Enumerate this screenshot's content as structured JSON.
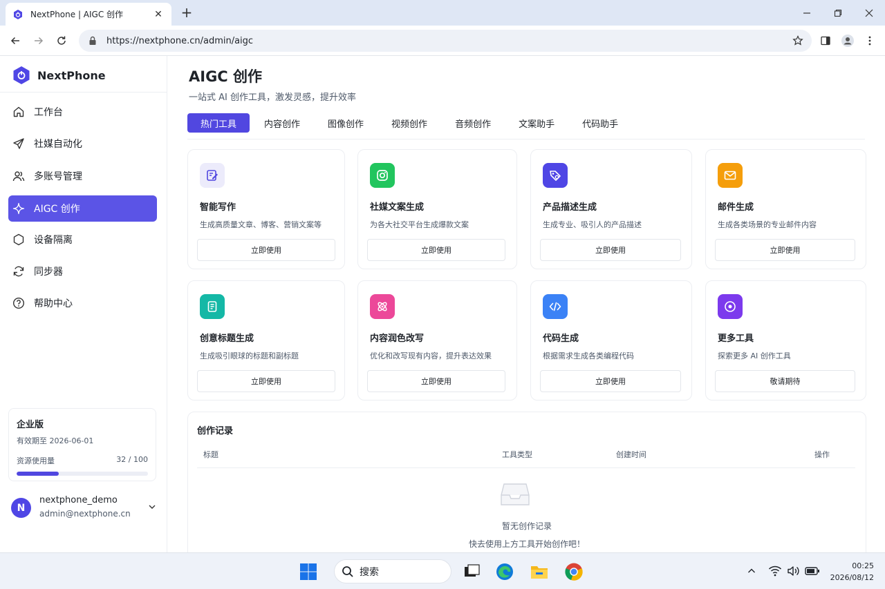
{
  "browser": {
    "tab_title": "NextPhone | AIGC 创作",
    "url": "https://nextphone.cn/admin/aigc"
  },
  "sidebar": {
    "brand": "NextPhone",
    "items": [
      {
        "label": "工作台",
        "icon": "home-icon"
      },
      {
        "label": "社媒自动化",
        "icon": "send-icon"
      },
      {
        "label": "多账号管理",
        "icon": "users-icon"
      },
      {
        "label": "AIGC 创作",
        "icon": "sparkle-icon",
        "active": true
      },
      {
        "label": "设备隔离",
        "icon": "hexagon-icon"
      },
      {
        "label": "同步器",
        "icon": "sync-icon"
      },
      {
        "label": "帮助中心",
        "icon": "help-icon"
      }
    ],
    "plan": {
      "name": "企业版",
      "expiry": "有效期至 2026-06-01",
      "usage_label": "资源使用量",
      "usage_text": "32 / 100",
      "usage_fraction": 0.32
    },
    "user": {
      "initial": "N",
      "name": "nextphone_demo",
      "email": "admin@nextphone.cn"
    }
  },
  "main": {
    "title": "AIGC 创作",
    "subtitle": "一站式 AI 创作工具，激发灵感，提升效率",
    "tabs": [
      "热门工具",
      "内容创作",
      "图像创作",
      "视频创作",
      "音频创作",
      "文案助手",
      "代码助手"
    ],
    "active_tab": 0,
    "cards": [
      {
        "title": "智能写作",
        "desc": "生成高质量文章、博客、营销文案等",
        "button": "立即使用",
        "icon": "edit-icon",
        "color": "#ecebfb",
        "fg": "#5147e0"
      },
      {
        "title": "社媒文案生成",
        "desc": "为各大社交平台生成爆款文案",
        "button": "立即使用",
        "icon": "camera-icon",
        "color": "#22c55e",
        "fg": "#ffffff"
      },
      {
        "title": "产品描述生成",
        "desc": "生成专业、吸引人的产品描述",
        "button": "立即使用",
        "icon": "tag-icon",
        "color": "#4f46e5",
        "fg": "#ffffff"
      },
      {
        "title": "邮件生成",
        "desc": "生成各类场景的专业邮件内容",
        "button": "立即使用",
        "icon": "mail-icon",
        "color": "#f59e0b",
        "fg": "#ffffff"
      },
      {
        "title": "创意标题生成",
        "desc": "生成吸引眼球的标题和副标题",
        "button": "立即使用",
        "icon": "document-icon",
        "color": "#14b8a6",
        "fg": "#ffffff"
      },
      {
        "title": "内容润色改写",
        "desc": "优化和改写现有内容，提升表达效果",
        "button": "立即使用",
        "icon": "atom-icon",
        "color": "#ec4899",
        "fg": "#ffffff"
      },
      {
        "title": "代码生成",
        "desc": "根据需求生成各类编程代码",
        "button": "立即使用",
        "icon": "code-icon",
        "color": "#3b82f6",
        "fg": "#ffffff"
      },
      {
        "title": "更多工具",
        "desc": "探索更多 AI 创作工具",
        "button": "敬请期待",
        "icon": "target-icon",
        "color": "#7c3aed",
        "fg": "#ffffff"
      }
    ],
    "records": {
      "title": "创作记录",
      "columns": [
        "标题",
        "工具类型",
        "创建时间",
        "操作"
      ],
      "empty_title": "暂无创作记录",
      "empty_hint": "快去使用上方工具开始创作吧！"
    }
  },
  "taskbar": {
    "search": "搜索",
    "time": "00:25",
    "date": "2026/08/12"
  }
}
